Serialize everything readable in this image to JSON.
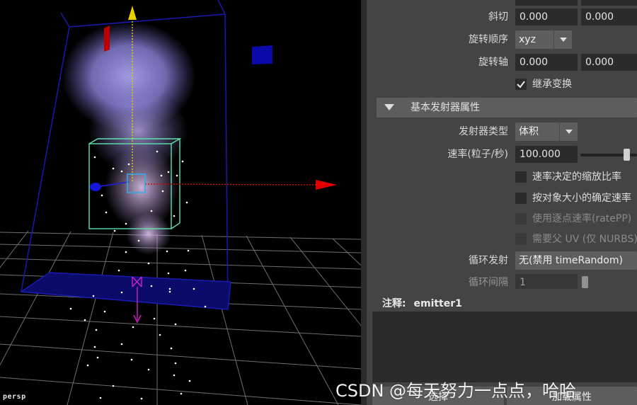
{
  "viewport": {
    "camera_label": "persp"
  },
  "transform": {
    "shear_label": "斜切",
    "shear": [
      "0.000",
      "0.000"
    ],
    "rotate_order_label": "旋转顺序",
    "rotate_order": "xyz",
    "rotate_axis_label": "旋转轴",
    "rotate_axis": [
      "0.000",
      "0.000"
    ],
    "inherit_transform_label": "继承变换",
    "inherit_transform_checked": true
  },
  "emitter_section": {
    "title": "基本发射器属性",
    "emitter_type_label": "发射器类型",
    "emitter_type": "体积",
    "rate_label": "速率(粒子/秒)",
    "rate": "100.000",
    "rate_slider_fraction": 0.82,
    "checkboxes": [
      {
        "label": "速率决定的缩放比率",
        "enabled": true,
        "checked": false
      },
      {
        "label": "按对象大小的确定速率",
        "enabled": true,
        "checked": false
      },
      {
        "label": "使用逐点速率(ratePP)",
        "enabled": false,
        "checked": false
      },
      {
        "label": "需要父 UV (仅 NURBS)",
        "enabled": false,
        "checked": false
      }
    ],
    "cycle_emission_label": "循环发射",
    "cycle_emission": "无(禁用 timeRandom)",
    "cycle_interval_label": "循环间隔",
    "cycle_interval": "1"
  },
  "notes": {
    "label": "注释:",
    "node": "emitter1"
  },
  "buttons": {
    "select": "选择",
    "load_attributes": "加载属性"
  },
  "watermark": "CSDN @每天努力一点点，哈哈",
  "colors": {
    "viewport_bg": "#000000",
    "panel_bg": "#444444",
    "field_bg": "#2b2b2b",
    "header_bg": "#5d5d5d",
    "axis_x": "#e00000",
    "axis_y": "#e6d000",
    "volume_box": "#60e0b0",
    "smoke": "#9a90e8"
  }
}
